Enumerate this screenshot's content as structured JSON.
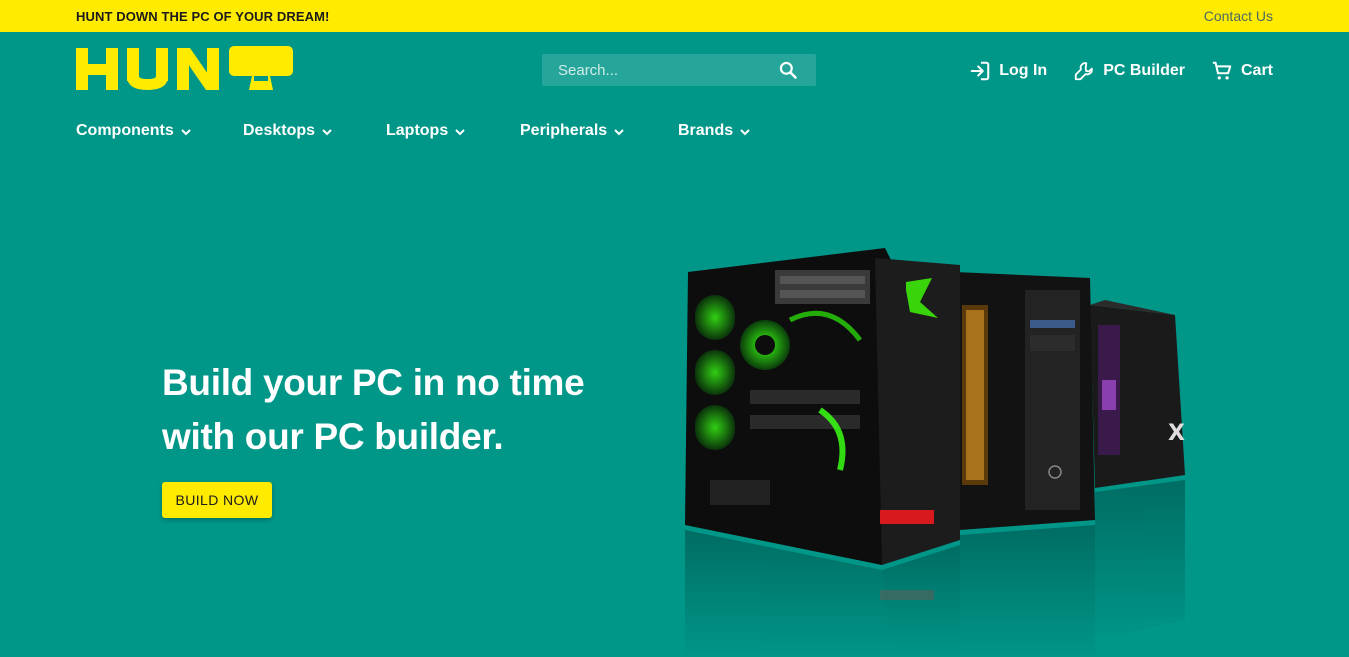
{
  "topbar": {
    "promo": "HUNT DOWN THE PC OF YOUR DREAM!",
    "contact": "Contact Us"
  },
  "header": {
    "logo_text": "HUNT",
    "search": {
      "placeholder": "Search..."
    },
    "actions": [
      {
        "label": "Log In",
        "icon": "login-icon"
      },
      {
        "label": "PC Builder",
        "icon": "wrench-icon"
      },
      {
        "label": "Cart",
        "icon": "cart-icon"
      }
    ]
  },
  "nav": {
    "items": [
      {
        "label": "Components"
      },
      {
        "label": "Desktops"
      },
      {
        "label": "Laptops"
      },
      {
        "label": "Peripherals"
      },
      {
        "label": "Brands"
      }
    ]
  },
  "hero": {
    "title_line1": "Build your PC in no time",
    "title_line2": "with our PC builder.",
    "cta": "BUILD NOW",
    "image": "gaming-pc-cases-image"
  },
  "colors": {
    "primary": "#009688",
    "accent": "#ffeb00",
    "search_bg": "#26a69a"
  }
}
